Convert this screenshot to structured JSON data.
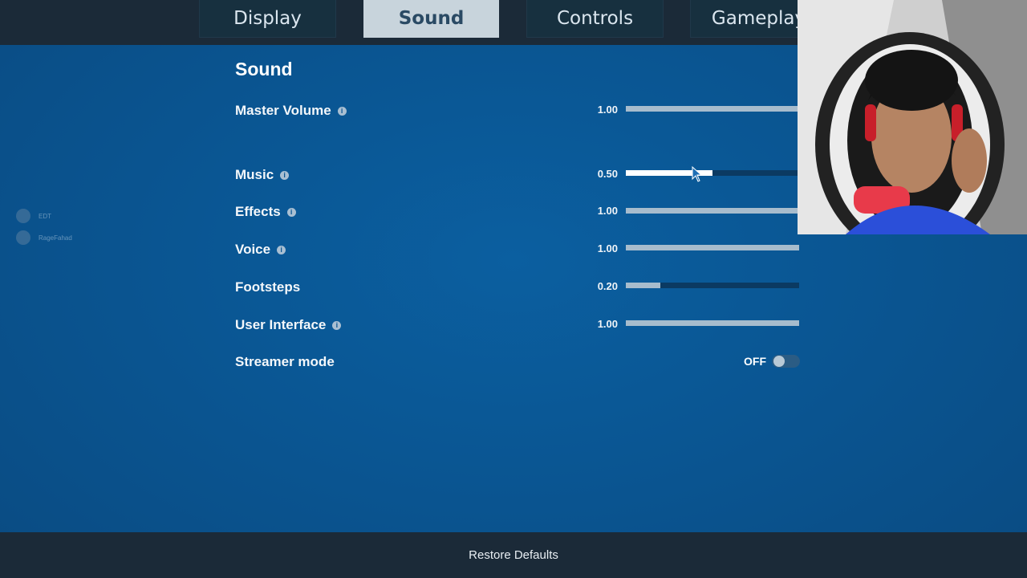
{
  "tabs": [
    {
      "label": "Display",
      "active": false
    },
    {
      "label": "Sound",
      "active": true
    },
    {
      "label": "Controls",
      "active": false
    },
    {
      "label": "Gameplay",
      "active": false
    }
  ],
  "section_title": "Sound",
  "settings": [
    {
      "label": "Master Volume",
      "value": "1.00",
      "level": 1.0,
      "info": true
    },
    {
      "label": "Music",
      "value": "0.50",
      "level": 0.5,
      "info": true
    },
    {
      "label": "Effects",
      "value": "1.00",
      "level": 1.0,
      "info": true
    },
    {
      "label": "Voice",
      "value": "1.00",
      "level": 1.0,
      "info": true
    },
    {
      "label": "Footsteps",
      "value": "0.20",
      "level": 0.2,
      "info": false
    },
    {
      "label": "User Interface",
      "value": "1.00",
      "level": 1.0,
      "info": true
    }
  ],
  "streamer_mode": {
    "label": "Streamer mode",
    "state": "OFF"
  },
  "footer": {
    "restore_label": "Restore Defaults"
  },
  "party": [
    {
      "name": "EDT"
    },
    {
      "name": "RageFahad"
    }
  ],
  "info_icon_glyph": "i",
  "colors": {
    "background": "#0a5693",
    "bar": "#1b2a38",
    "active_tab": "#c8d4dc",
    "slider_fill": "#a7bccd"
  }
}
